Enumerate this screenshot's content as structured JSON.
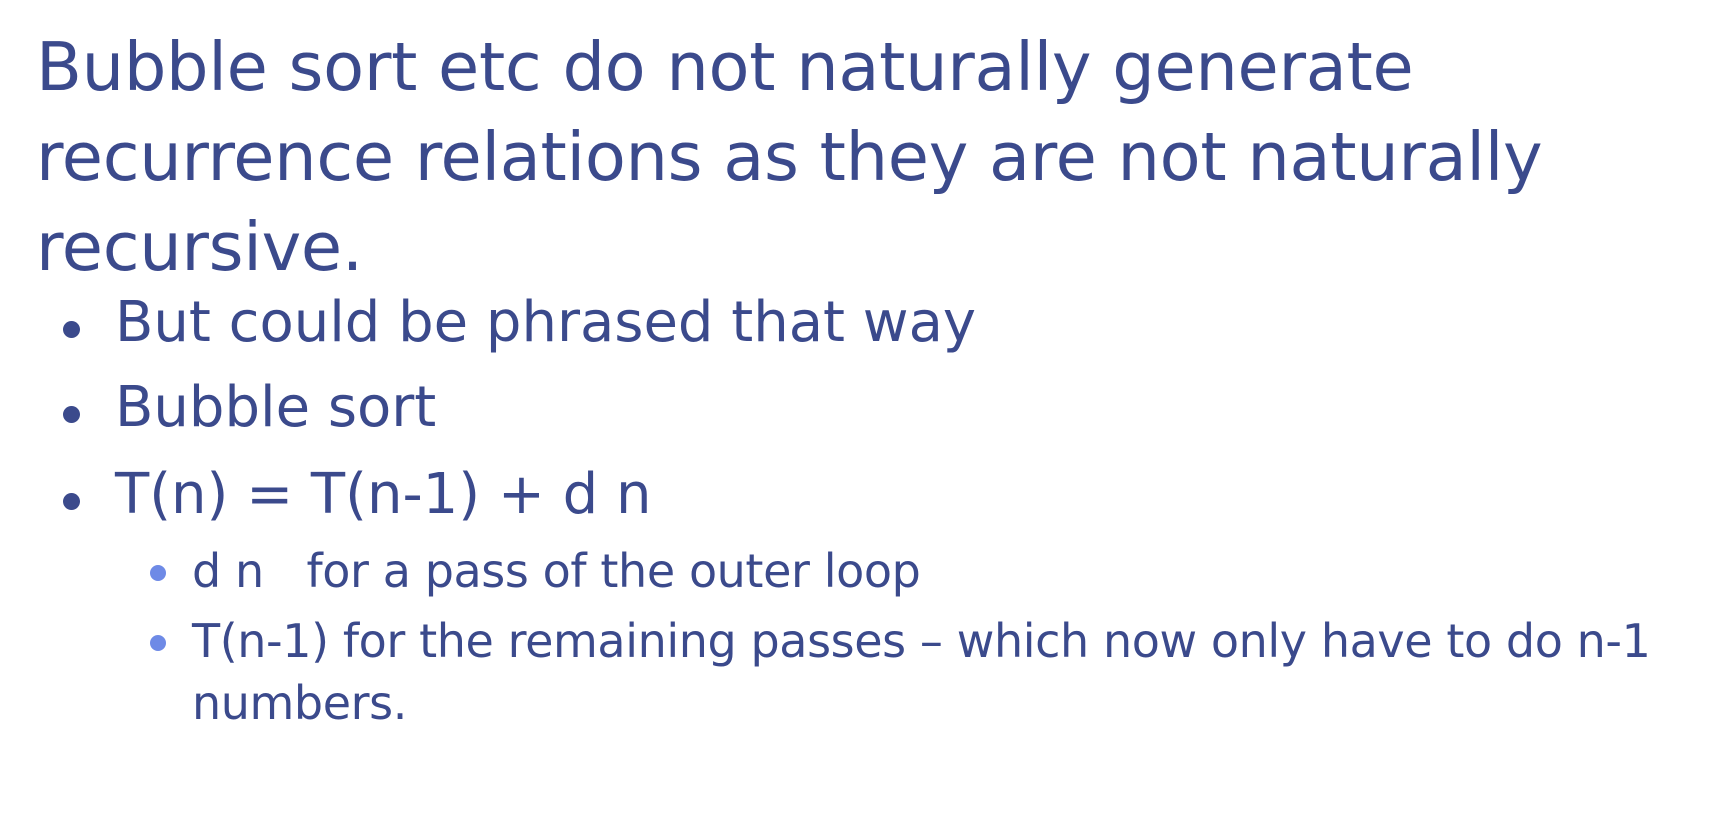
{
  "slide": {
    "title": "Bubble sort etc do not naturally generate recurrence relations as they are not naturally recursive.",
    "bullets": [
      {
        "level": 1,
        "text": "But could be phrased that way"
      },
      {
        "level": 1,
        "text": "Bubble sort"
      },
      {
        "level": 1,
        "text": "T(n) = T(n-1) + d n"
      },
      {
        "level": 2,
        "text": "d n   for a pass of the outer loop"
      },
      {
        "level": 2,
        "text": "T(n-1)  for the remaining passes – which now only have to do n-1 numbers."
      }
    ],
    "colors": {
      "text": "#3b4a8c",
      "sub_bullet": "#6e8ae6",
      "background": "#ffffff"
    }
  }
}
